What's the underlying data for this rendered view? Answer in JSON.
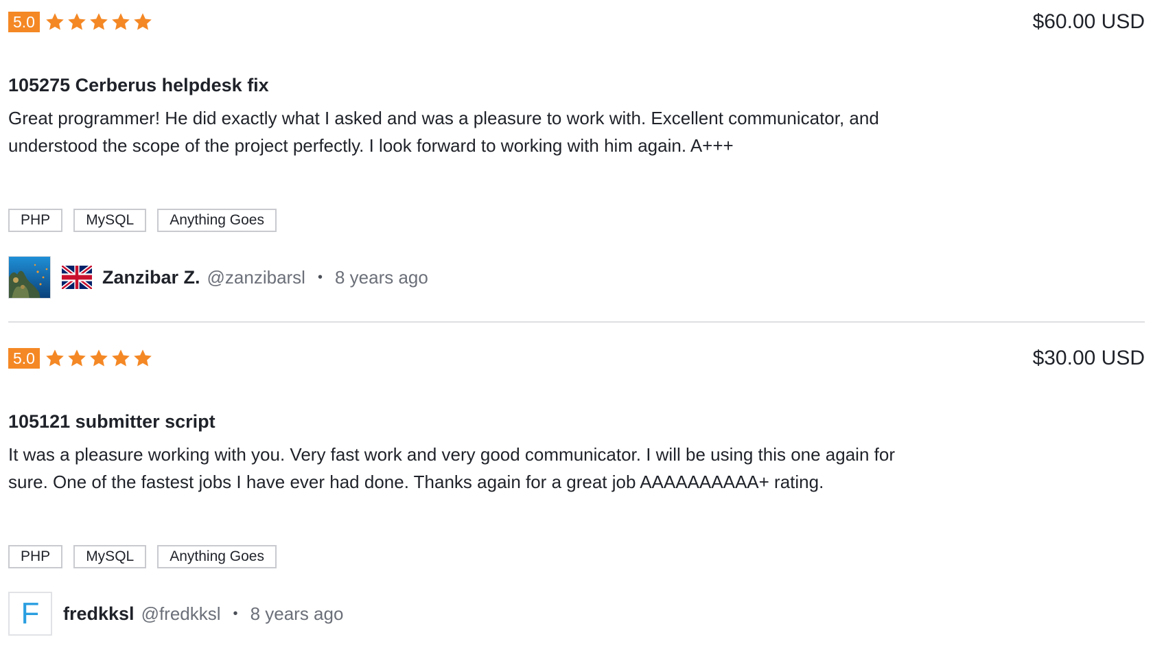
{
  "accent_color": "#f48825",
  "reviews": [
    {
      "rating": "5.0",
      "stars_filled": 5,
      "stars_total": 5,
      "price": "$60.00 USD",
      "project_title": "105275 Cerberus helpdesk fix",
      "text": "Great programmer! He did exactly what I asked and was a pleasure to work with. Excellent communicator, and understood the scope of the project perfectly. I look forward to working with him again. A+++",
      "skills": [
        "PHP",
        "MySQL",
        "Anything Goes"
      ],
      "reviewer": {
        "name": "Zanzibar Z.",
        "handle": "@zanzibarsl",
        "time": "8 years ago",
        "avatar_icon": "coral-reef-photo",
        "flag_icon": "uk-flag-icon"
      }
    },
    {
      "rating": "5.0",
      "stars_filled": 5,
      "stars_total": 5,
      "price": "$30.00 USD",
      "project_title": "105121 submitter script",
      "text": "It was a pleasure working with you. Very fast work and very good communicator. I will be using this one again for sure. One of the fastest jobs I have ever had done. Thanks again for a great job AAAAAAAAAA+ rating.",
      "skills": [
        "PHP",
        "MySQL",
        "Anything Goes"
      ],
      "reviewer": {
        "name": "fredkksl",
        "handle": "@fredkksl",
        "time": "8 years ago",
        "avatar_letter": "F"
      }
    }
  ],
  "separator": "•"
}
